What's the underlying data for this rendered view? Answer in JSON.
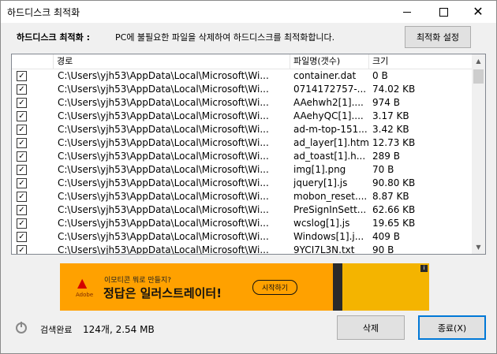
{
  "window": {
    "title": "하드디스크 최적화"
  },
  "info": {
    "label": "하드디스크 최적화 :",
    "text": "PC에 불필요한 파일을 삭제하여 하드디스크를 최적화합니다."
  },
  "buttons": {
    "settings": "최적화 설정",
    "delete": "삭제",
    "exit": "종료(X)"
  },
  "table": {
    "headers": {
      "path": "경로",
      "name": "파일명(갯수)",
      "size": "크기"
    },
    "rows": [
      {
        "checked": true,
        "path": "C:\\Users\\yjh53\\AppData\\Local\\Microsoft\\Wi...",
        "name": "container.dat",
        "size": "0 B"
      },
      {
        "checked": true,
        "path": "C:\\Users\\yjh53\\AppData\\Local\\Microsoft\\Wi...",
        "name": "0714172757-...",
        "size": "74.02 KB"
      },
      {
        "checked": true,
        "path": "C:\\Users\\yjh53\\AppData\\Local\\Microsoft\\Wi...",
        "name": "AAehwh2[1]....",
        "size": "974 B"
      },
      {
        "checked": true,
        "path": "C:\\Users\\yjh53\\AppData\\Local\\Microsoft\\Wi...",
        "name": "AAehyQC[1]....",
        "size": "3.17 KB"
      },
      {
        "checked": true,
        "path": "C:\\Users\\yjh53\\AppData\\Local\\Microsoft\\Wi...",
        "name": "ad-m-top-151...",
        "size": "3.42 KB"
      },
      {
        "checked": true,
        "path": "C:\\Users\\yjh53\\AppData\\Local\\Microsoft\\Wi...",
        "name": "ad_layer[1].htm",
        "size": "12.73 KB"
      },
      {
        "checked": true,
        "path": "C:\\Users\\yjh53\\AppData\\Local\\Microsoft\\Wi...",
        "name": "ad_toast[1].h...",
        "size": "289 B"
      },
      {
        "checked": true,
        "path": "C:\\Users\\yjh53\\AppData\\Local\\Microsoft\\Wi...",
        "name": "img[1].png",
        "size": "70 B"
      },
      {
        "checked": true,
        "path": "C:\\Users\\yjh53\\AppData\\Local\\Microsoft\\Wi...",
        "name": "jquery[1].js",
        "size": "90.80 KB"
      },
      {
        "checked": true,
        "path": "C:\\Users\\yjh53\\AppData\\Local\\Microsoft\\Wi...",
        "name": "mobon_reset....",
        "size": "8.87 KB"
      },
      {
        "checked": true,
        "path": "C:\\Users\\yjh53\\AppData\\Local\\Microsoft\\Wi...",
        "name": "PreSignInSett...",
        "size": "62.66 KB"
      },
      {
        "checked": true,
        "path": "C:\\Users\\yjh53\\AppData\\Local\\Microsoft\\Wi...",
        "name": "wcslog[1].js",
        "size": "19.65 KB"
      },
      {
        "checked": true,
        "path": "C:\\Users\\yjh53\\AppData\\Local\\Microsoft\\Wi...",
        "name": "Windows[1].j...",
        "size": "409 B"
      },
      {
        "checked": true,
        "path": "C:\\Users\\yjh53\\AppData\\Local\\Microsoft\\Wi...",
        "name": "9YCI7L3N.txt",
        "size": "90 B"
      }
    ]
  },
  "ad": {
    "logo_text": "Adobe",
    "subtitle": "이모티콘 뭐로 만들지?",
    "headline": "정답은 일러스트레이터!",
    "cta": "시작하기",
    "colors": {
      "bg": "#ffa100",
      "logo": "#d40000"
    }
  },
  "status": {
    "label": "검색완료",
    "summary": "124개, 2.54 MB"
  }
}
